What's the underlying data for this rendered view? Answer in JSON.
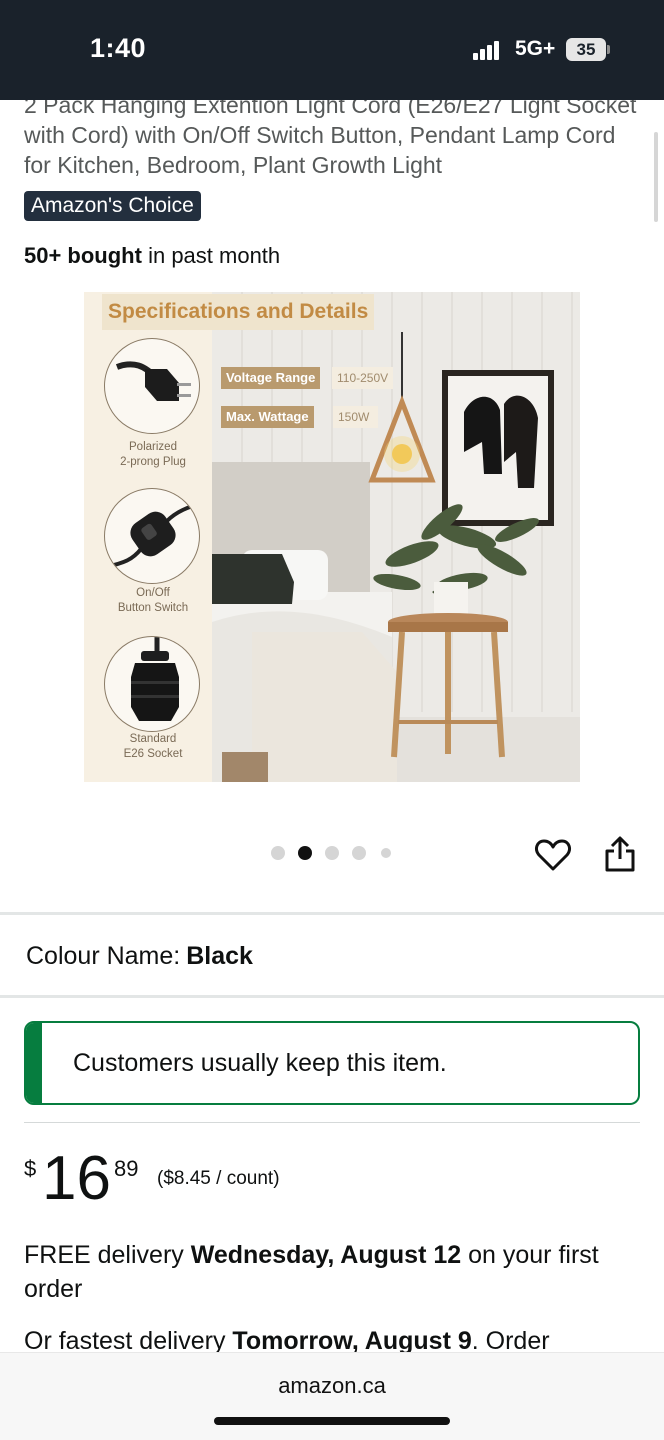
{
  "status_bar": {
    "time": "1:40",
    "network": "5G+",
    "battery": "35"
  },
  "product": {
    "title": "2 Pack Hanging Extention Light Cord (E26/E27 Light Socket with Cord) with On/Off Switch Button, Pendant Lamp Cord for Kitchen, Bedroom, Plant Growth Light",
    "badge": "Amazon's Choice",
    "bought_bold": "50+ bought",
    "bought_rest": "in past month"
  },
  "image": {
    "spec_title": "Specifications and Details",
    "plug_label_1": "Polarized",
    "plug_label_2": "2-prong Plug",
    "switch_label_1": "On/Off",
    "switch_label_2": "Button Switch",
    "socket_label_1": "Standard",
    "socket_label_2": "E26 Socket",
    "voltage_key": "Voltage Range",
    "voltage_val": "110-250V",
    "wattage_key": "Max. Wattage",
    "wattage_val": "150W"
  },
  "carousel": {
    "count": 5,
    "active_index": 1
  },
  "variant": {
    "label": "Colour Name:",
    "value": "Black"
  },
  "keep_notice": "Customers usually keep this item.",
  "price": {
    "symbol": "$",
    "whole": "16",
    "fraction": "89",
    "per_unit": "($8.45 / count)"
  },
  "delivery": {
    "prefix": "FREE delivery",
    "date": "Wednesday, August 12",
    "suffix": "on your first order"
  },
  "fastest": {
    "prefix": "Or fastest delivery",
    "date": "Tomorrow, August 9",
    "suffix": ". Order"
  },
  "browser": {
    "domain": "amazon.ca"
  },
  "colors": {
    "status_bar_bg": "#1a222b",
    "badge_bg": "#232f3e",
    "keep_green": "#067d3f"
  }
}
